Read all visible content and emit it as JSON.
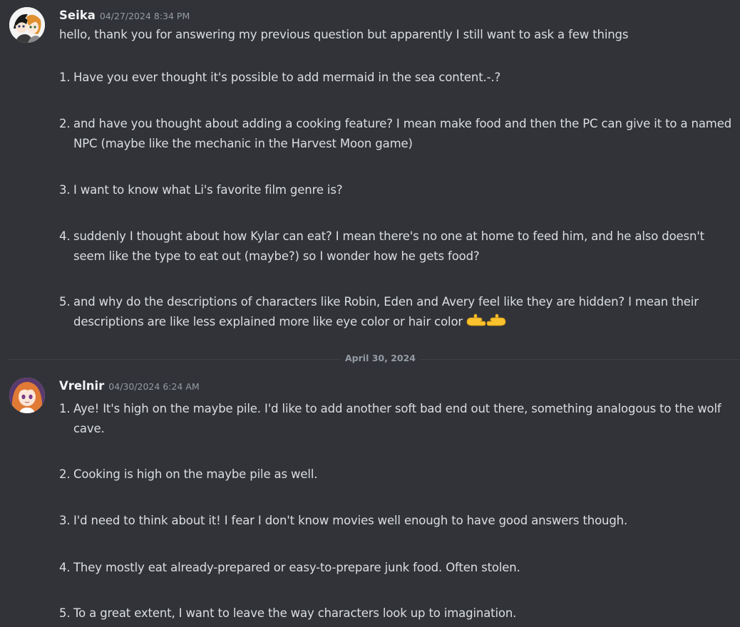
{
  "messages": [
    {
      "username": "Seika",
      "timestamp": "04/27/2024 8:34 PM",
      "intro": "hello, thank you for answering my previous question but apparently I still want to ask a few things",
      "items": [
        {
          "num": "1.",
          "text": "Have you ever thought it's possible to add mermaid in the sea content.-.?"
        },
        {
          "num": "2.",
          "text": "and have you thought about adding a cooking feature?  I mean make food and then the PC can give it to a named NPC (maybe like the mechanic in the Harvest Moon game)"
        },
        {
          "num": "3.",
          "text": "I want to know what Li's favorite film genre is?"
        },
        {
          "num": "4.",
          "text": "suddenly I thought about how Kylar can eat?  I mean there's no one at home to feed him, and he also doesn't seem like the type to eat out (maybe?) so I wonder how he gets food?"
        },
        {
          "num": "5.",
          "text": "and why do the descriptions of characters like Robin, Eden and Avery feel like they are hidden?  I mean their descriptions are like less explained more like eye color or hair color",
          "emoji": "pointing-fingers-emoji"
        }
      ]
    },
    {
      "username": "Vrelnir",
      "timestamp": "04/30/2024 6:24 AM",
      "items": [
        {
          "num": "1.",
          "text": "Aye! It's high on the maybe pile. I'd like to add another soft bad end out there, something analogous to the wolf cave."
        },
        {
          "num": "2.",
          "text": "Cooking is high on the maybe pile as well."
        },
        {
          "num": "3.",
          "text": "I'd need to think about it! I fear I don't know movies well enough to have good answers though."
        },
        {
          "num": "4.",
          "text": "They mostly eat already-prepared or easy-to-prepare junk food. Often stolen."
        },
        {
          "num": "5.",
          "text": "To a great extent, I want to leave the way characters look up to imagination."
        }
      ]
    }
  ],
  "date_divider": "April 30, 2024",
  "colors": {
    "background": "#313338",
    "text": "#dbdee1",
    "username": "#f2f3f5",
    "muted": "#949ba4",
    "divider": "#3f4147"
  }
}
